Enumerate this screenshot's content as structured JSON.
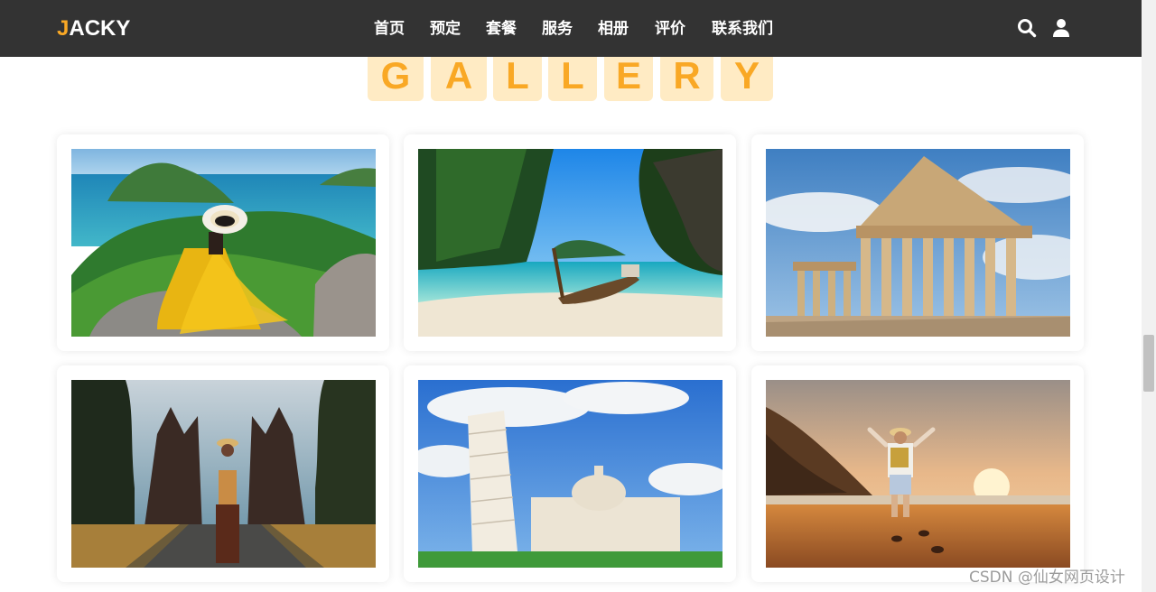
{
  "brand": {
    "first_letter": "J",
    "rest": "ACKY",
    "accent_color": "#f9a825"
  },
  "nav": {
    "items": [
      "首页",
      "预定",
      "套餐",
      "服务",
      "相册",
      "评价",
      "联系我们"
    ]
  },
  "header_icons": [
    "search-icon",
    "user-icon"
  ],
  "gallery": {
    "letters": [
      "G",
      "A",
      "L",
      "L",
      "E",
      "R",
      "Y"
    ],
    "photos": [
      {
        "name": "island-woman-yellow-dress"
      },
      {
        "name": "longtail-boat-beach"
      },
      {
        "name": "parthenon"
      },
      {
        "name": "bali-temple-gate"
      },
      {
        "name": "leaning-tower-pisa"
      },
      {
        "name": "beach-sunset-hiker"
      }
    ]
  },
  "watermark": "CSDN @仙女网页设计"
}
